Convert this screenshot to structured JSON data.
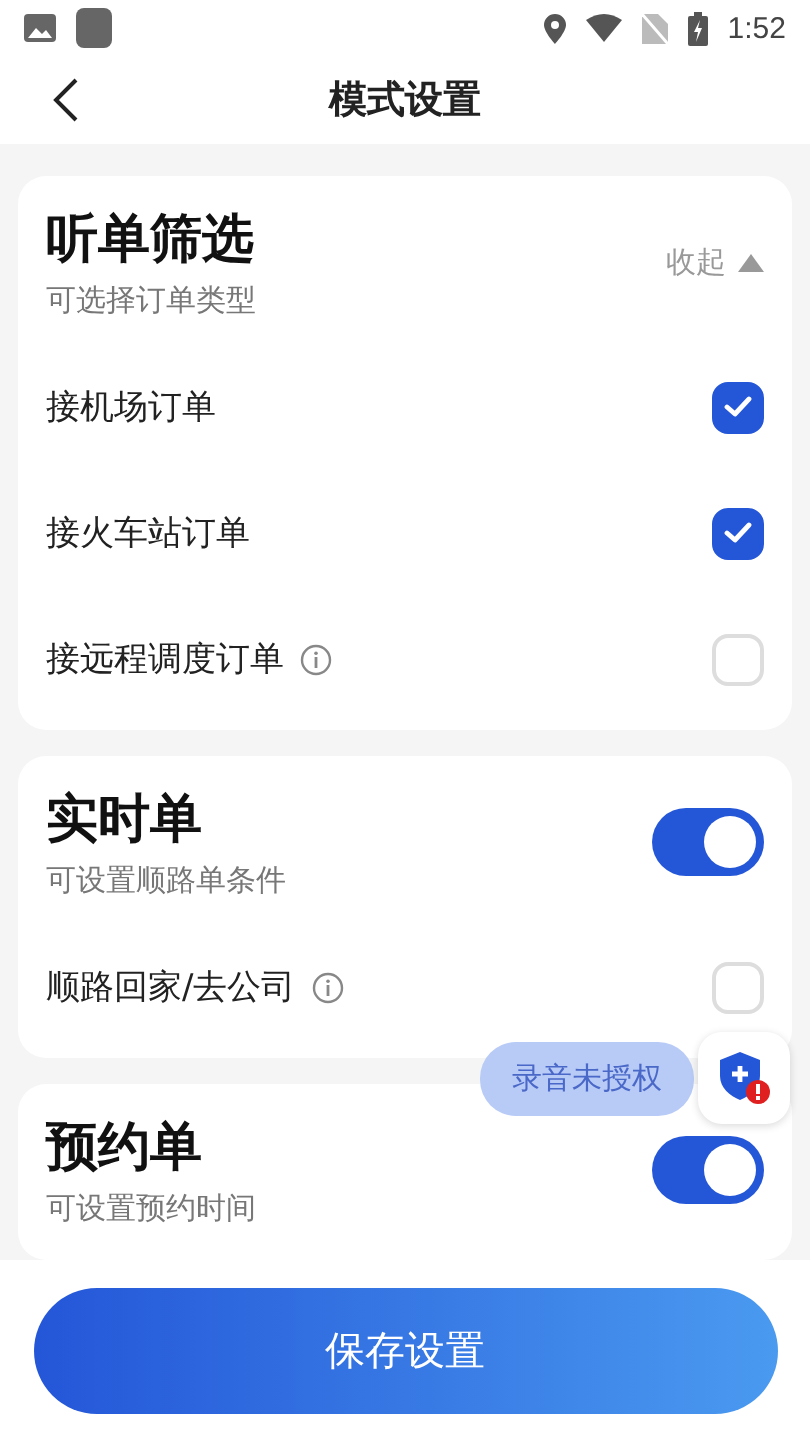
{
  "status_bar": {
    "time": "1:52"
  },
  "header": {
    "title": "模式设置"
  },
  "sections": [
    {
      "title": "听单筛选",
      "subtitle": "可选择订单类型",
      "collapse": {
        "label": "收起"
      },
      "options": [
        {
          "kind": "checkbox",
          "label": "接机场订单",
          "checked": true,
          "info": false
        },
        {
          "kind": "checkbox",
          "label": "接火车站订单",
          "checked": true,
          "info": false
        },
        {
          "kind": "checkbox",
          "label": "接远程调度订单",
          "checked": false,
          "info": true
        }
      ]
    },
    {
      "title": "实时单",
      "subtitle": "可设置顺路单条件",
      "on": true,
      "options": [
        {
          "kind": "checkbox",
          "label": "顺路回家/去公司",
          "checked": false,
          "info": true
        }
      ]
    },
    {
      "title": "预约单",
      "subtitle": "可设置预约时间",
      "on": true
    }
  ],
  "floating_badge": {
    "label": "录音未授权"
  },
  "save_button": {
    "label": "保存设置"
  }
}
